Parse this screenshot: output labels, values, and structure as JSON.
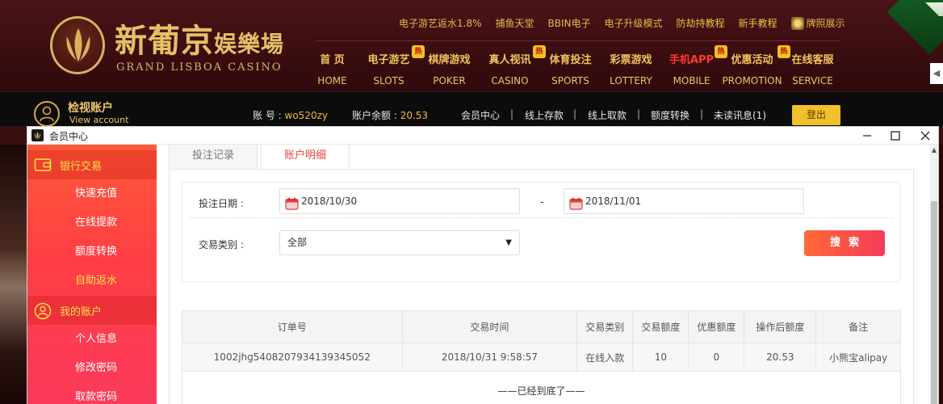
{
  "logo": {
    "cn_main": "新葡京",
    "cn_small": "娱樂場",
    "en": "GRAND LISBOA CASINO"
  },
  "promo_links": [
    {
      "label": "电子游艺返水1.8%"
    },
    {
      "label": "捕鱼天堂"
    },
    {
      "label": "BBIN电子"
    },
    {
      "label": "电子升级模式"
    },
    {
      "label": "防劫持教程"
    },
    {
      "label": "新手教程"
    },
    {
      "label": "牌照展示",
      "icon": "baccarat-icon"
    }
  ],
  "nav": [
    {
      "cn": "首 页",
      "en": "HOME",
      "hot": false
    },
    {
      "cn": "电子游艺",
      "en": "SLOTS",
      "hot": true
    },
    {
      "cn": "棋牌游戏",
      "en": "POKER",
      "hot": false
    },
    {
      "cn": "真人视讯",
      "en": "CASINO",
      "hot": true
    },
    {
      "cn": "体育投注",
      "en": "SPORTS",
      "hot": false
    },
    {
      "cn": "彩票游戏",
      "en": "LOTTERY",
      "hot": false
    },
    {
      "cn": "手机APP",
      "en": "MOBILE",
      "hot": true
    },
    {
      "cn": "优惠活动",
      "en": "PROMOTION",
      "hot": false
    },
    {
      "cn": "在线客服",
      "en": "SERVICE",
      "hot": true
    }
  ],
  "hot_badge": "热",
  "account": {
    "title": "检视账户",
    "subtitle": "View account",
    "username_label": "账 号 :",
    "username": "wo520zy",
    "balance_label": "账户余额 :",
    "balance": "20.53",
    "links": [
      "会员中心",
      "线上存款",
      "线上取款",
      "额度转换",
      "未读讯息(1)"
    ],
    "separator": "|",
    "logout": "登出"
  },
  "window": {
    "title": "会员中心"
  },
  "sidebar": {
    "sections": [
      {
        "label": "银行交易",
        "icon": "wallet-icon",
        "items": [
          {
            "label": "快速充值",
            "highlight": false
          },
          {
            "label": "在线提款",
            "highlight": false
          },
          {
            "label": "额度转换",
            "highlight": false
          },
          {
            "label": "自助返水",
            "highlight": true
          }
        ]
      },
      {
        "label": "我的账户",
        "icon": "user-icon",
        "items": [
          {
            "label": "个人信息",
            "highlight": false
          },
          {
            "label": "修改密码",
            "highlight": false
          },
          {
            "label": "取款密码",
            "highlight": false
          }
        ]
      }
    ]
  },
  "tabs": [
    {
      "label": "投注记录",
      "active": false
    },
    {
      "label": "账户明细",
      "active": true
    }
  ],
  "filter": {
    "date_label": "投注日期 :",
    "date_from": "2018/10/30",
    "date_dash": "-",
    "date_to": "2018/11/01",
    "type_label": "交易类别 :",
    "type_value": "全部",
    "search_button": "搜索"
  },
  "table": {
    "columns": [
      "订单号",
      "交易时间",
      "交易类别",
      "交易额度",
      "优惠额度",
      "操作后额度",
      "备注"
    ],
    "rows": [
      [
        "1002jhg5408207934139345052",
        "2018/10/31 9:58:57",
        "在线入款",
        "10",
        "0",
        "20.53",
        "小熊宝alipay"
      ]
    ],
    "end_text": "——已经到底了——"
  },
  "colors": {
    "accent_red": "#f43c5a",
    "accent_orange": "#ff6a36",
    "gold": "#f0c55a",
    "sidebar_highlight": "#ffe14a"
  }
}
